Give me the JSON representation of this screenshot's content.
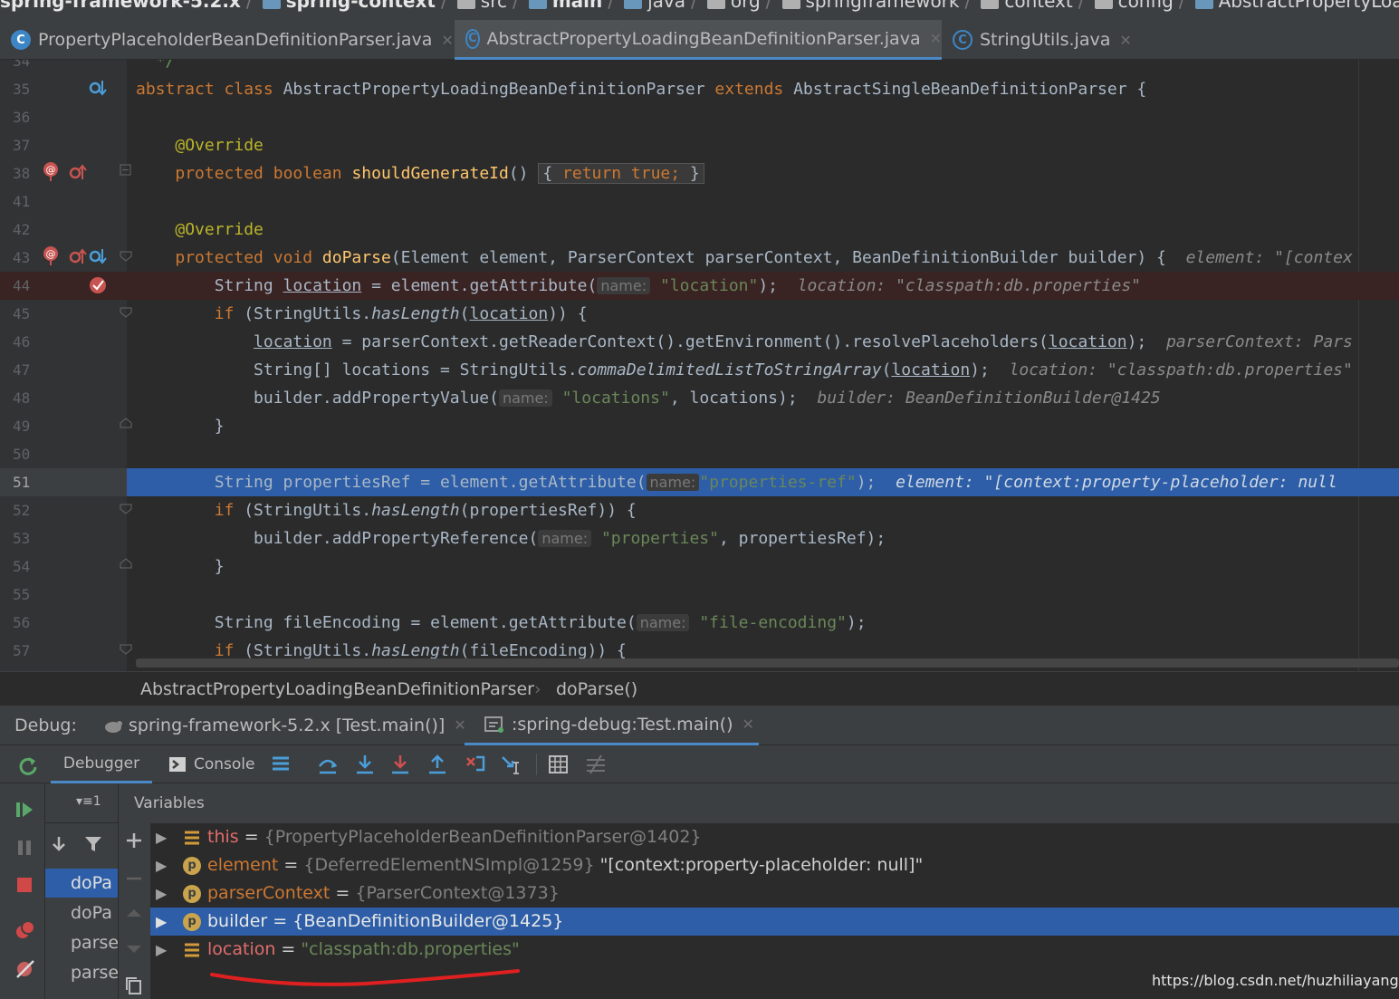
{
  "navbar": {
    "crumbs": [
      "spring-framework-5.2.x",
      "spring-context",
      "src",
      "main",
      "java",
      "org",
      "springframework",
      "context",
      "config",
      "AbstractPropertyLoadingBeanDe"
    ]
  },
  "tabs": [
    {
      "label": "PropertyPlaceholderBeanDefinitionParser.java",
      "icon": "C"
    },
    {
      "label": "AbstractPropertyLoadingBeanDefinitionParser.java",
      "icon": "C"
    },
    {
      "label": "StringUtils.java",
      "icon": "C"
    }
  ],
  "editor": {
    "lines": [
      {
        "n": "34"
      },
      {
        "n": "35"
      },
      {
        "n": "36"
      },
      {
        "n": "37"
      },
      {
        "n": "38"
      },
      {
        "n": "41"
      },
      {
        "n": "42"
      },
      {
        "n": "43"
      },
      {
        "n": "44"
      },
      {
        "n": "45"
      },
      {
        "n": "46"
      },
      {
        "n": "47"
      },
      {
        "n": "48"
      },
      {
        "n": "49"
      },
      {
        "n": "50"
      },
      {
        "n": "51"
      },
      {
        "n": "52"
      },
      {
        "n": "53"
      },
      {
        "n": "54"
      },
      {
        "n": "55"
      },
      {
        "n": "56"
      },
      {
        "n": "57"
      }
    ],
    "code": {
      "l35_kw": "abstract class ",
      "l35_name": "AbstractPropertyLoadingBeanDefinitionParser ",
      "l35_ext": "extends ",
      "l35_super": "AbstractSingleBeanDefinitionParser {",
      "l37": "@Override",
      "l38_kw": "protected boolean ",
      "l38_fn": "shouldGenerateId",
      "l38_p": "()",
      "l38_body_open": "{ ",
      "l38_ret": "return true;",
      "l38_body_close": " }",
      "l42": "@Override",
      "l43_kw": "protected void ",
      "l43_fn": "doParse",
      "l43_args": "(Element element, ParserContext parserContext, BeanDefinitionBuilder builder) {",
      "l43_inl": "element: \"[contex",
      "l44_a": "String ",
      "l44_var": "location",
      "l44_b": " = element.getAttribute(",
      "l44_hint": "name:",
      "l44_str": "\"location\"",
      "l44_c": ");",
      "l44_inl": "location: \"classpath:db.properties\"",
      "l45_kw": "if ",
      "l45_a": "(StringUtils.",
      "l45_it": "hasLength",
      "l45_b": "(",
      "l45_var": "location",
      "l45_c": ")) {",
      "l46_var": "location",
      "l46_a": " = parserContext.getReaderContext().getEnvironment().resolvePlaceholders(",
      "l46_var2": "location",
      "l46_b": ");",
      "l46_inl": "parserContext: Pars",
      "l47_a": "String[] locations = StringUtils.",
      "l47_it": "commaDelimitedListToStringArray",
      "l47_b": "(",
      "l47_var": "location",
      "l47_c": ");",
      "l47_inl": "location: \"classpath:db.properties\"",
      "l48_a": "builder.addPropertyValue(",
      "l48_hint": "name:",
      "l48_str": "\"locations\"",
      "l48_b": ", locations);",
      "l48_inl": "builder: BeanDefinitionBuilder@1425",
      "l49": "}",
      "l51_a": "String propertiesRef = element.getAttribute(",
      "l51_hint": "name:",
      "l51_str": "\"properties-ref\"",
      "l51_b": ");",
      "l51_inl": "element: \"[context:property-placeholder: null",
      "l52_kw": "if ",
      "l52_a": "(StringUtils.",
      "l52_it": "hasLength",
      "l52_b": "(propertiesRef)) {",
      "l53_a": "builder.addPropertyReference(",
      "l53_hint": "name:",
      "l53_str": "\"properties\"",
      "l53_b": ", propertiesRef);",
      "l54": "}",
      "l56_a": "String fileEncoding = element.getAttribute(",
      "l56_hint": "name:",
      "l56_str": "\"file-encoding\"",
      "l56_b": ");",
      "l57_kw": "if ",
      "l57_a": "(StringUtils.",
      "l57_it": "hasLength",
      "l57_b": "(fileEncoding)) {"
    }
  },
  "code_breadcrumb": {
    "class": "AbstractPropertyLoadingBeanDefinitionParser",
    "method": "doParse()"
  },
  "debug": {
    "label": "Debug:",
    "sessions": [
      {
        "label": "spring-framework-5.2.x [Test.main()]"
      },
      {
        "label": ":spring-debug:Test.main()"
      }
    ],
    "toolbar": {
      "debugger": "Debugger",
      "console": "Console"
    },
    "frames_filter": "▾≡1",
    "frames": [
      "doPa",
      "doPa",
      "parse",
      "parse"
    ],
    "variables_title": "Variables",
    "variables": [
      {
        "name": "this",
        "eq": " = ",
        "value": "{PropertyPlaceholderBeanDefinitionParser@1402}",
        "extra": ""
      },
      {
        "name": "element",
        "eq": " = ",
        "value": "{DeferredElementNSImpl@1259}",
        "extra": " \"[context:property-placeholder: null]\""
      },
      {
        "name": "parserContext",
        "eq": " = ",
        "value": "{ParserContext@1373}",
        "extra": ""
      },
      {
        "name": "builder",
        "eq": " = ",
        "value": "{BeanDefinitionBuilder@1425}",
        "extra": ""
      },
      {
        "name": "location",
        "eq": " = ",
        "value": "\"classpath:db.properties\"",
        "extra": ""
      }
    ]
  },
  "watermark": "https://blog.csdn.net/huzhiliayanghao",
  "colors": {
    "selection": "#2d5ea7",
    "keyword": "#cc7832",
    "string": "#6a8759",
    "annotation": "#bbb529",
    "breakpoint": "#c75450"
  }
}
